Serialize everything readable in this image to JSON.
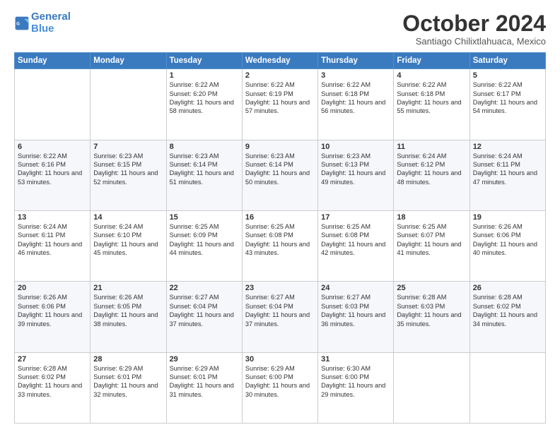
{
  "logo": {
    "line1": "General",
    "line2": "Blue"
  },
  "header": {
    "month_year": "October 2024",
    "location": "Santiago Chilixtlahuaca, Mexico"
  },
  "days_of_week": [
    "Sunday",
    "Monday",
    "Tuesday",
    "Wednesday",
    "Thursday",
    "Friday",
    "Saturday"
  ],
  "weeks": [
    [
      {
        "day": "",
        "empty": true
      },
      {
        "day": "",
        "empty": true
      },
      {
        "day": "1",
        "sunrise": "6:22 AM",
        "sunset": "6:20 PM",
        "daylight": "11 hours and 58 minutes."
      },
      {
        "day": "2",
        "sunrise": "6:22 AM",
        "sunset": "6:19 PM",
        "daylight": "11 hours and 57 minutes."
      },
      {
        "day": "3",
        "sunrise": "6:22 AM",
        "sunset": "6:18 PM",
        "daylight": "11 hours and 56 minutes."
      },
      {
        "day": "4",
        "sunrise": "6:22 AM",
        "sunset": "6:18 PM",
        "daylight": "11 hours and 55 minutes."
      },
      {
        "day": "5",
        "sunrise": "6:22 AM",
        "sunset": "6:17 PM",
        "daylight": "11 hours and 54 minutes."
      }
    ],
    [
      {
        "day": "6",
        "sunrise": "6:22 AM",
        "sunset": "6:16 PM",
        "daylight": "11 hours and 53 minutes."
      },
      {
        "day": "7",
        "sunrise": "6:23 AM",
        "sunset": "6:15 PM",
        "daylight": "11 hours and 52 minutes."
      },
      {
        "day": "8",
        "sunrise": "6:23 AM",
        "sunset": "6:14 PM",
        "daylight": "11 hours and 51 minutes."
      },
      {
        "day": "9",
        "sunrise": "6:23 AM",
        "sunset": "6:14 PM",
        "daylight": "11 hours and 50 minutes."
      },
      {
        "day": "10",
        "sunrise": "6:23 AM",
        "sunset": "6:13 PM",
        "daylight": "11 hours and 49 minutes."
      },
      {
        "day": "11",
        "sunrise": "6:24 AM",
        "sunset": "6:12 PM",
        "daylight": "11 hours and 48 minutes."
      },
      {
        "day": "12",
        "sunrise": "6:24 AM",
        "sunset": "6:11 PM",
        "daylight": "11 hours and 47 minutes."
      }
    ],
    [
      {
        "day": "13",
        "sunrise": "6:24 AM",
        "sunset": "6:11 PM",
        "daylight": "11 hours and 46 minutes."
      },
      {
        "day": "14",
        "sunrise": "6:24 AM",
        "sunset": "6:10 PM",
        "daylight": "11 hours and 45 minutes."
      },
      {
        "day": "15",
        "sunrise": "6:25 AM",
        "sunset": "6:09 PM",
        "daylight": "11 hours and 44 minutes."
      },
      {
        "day": "16",
        "sunrise": "6:25 AM",
        "sunset": "6:08 PM",
        "daylight": "11 hours and 43 minutes."
      },
      {
        "day": "17",
        "sunrise": "6:25 AM",
        "sunset": "6:08 PM",
        "daylight": "11 hours and 42 minutes."
      },
      {
        "day": "18",
        "sunrise": "6:25 AM",
        "sunset": "6:07 PM",
        "daylight": "11 hours and 41 minutes."
      },
      {
        "day": "19",
        "sunrise": "6:26 AM",
        "sunset": "6:06 PM",
        "daylight": "11 hours and 40 minutes."
      }
    ],
    [
      {
        "day": "20",
        "sunrise": "6:26 AM",
        "sunset": "6:06 PM",
        "daylight": "11 hours and 39 minutes."
      },
      {
        "day": "21",
        "sunrise": "6:26 AM",
        "sunset": "6:05 PM",
        "daylight": "11 hours and 38 minutes."
      },
      {
        "day": "22",
        "sunrise": "6:27 AM",
        "sunset": "6:04 PM",
        "daylight": "11 hours and 37 minutes."
      },
      {
        "day": "23",
        "sunrise": "6:27 AM",
        "sunset": "6:04 PM",
        "daylight": "11 hours and 37 minutes."
      },
      {
        "day": "24",
        "sunrise": "6:27 AM",
        "sunset": "6:03 PM",
        "daylight": "11 hours and 36 minutes."
      },
      {
        "day": "25",
        "sunrise": "6:28 AM",
        "sunset": "6:03 PM",
        "daylight": "11 hours and 35 minutes."
      },
      {
        "day": "26",
        "sunrise": "6:28 AM",
        "sunset": "6:02 PM",
        "daylight": "11 hours and 34 minutes."
      }
    ],
    [
      {
        "day": "27",
        "sunrise": "6:28 AM",
        "sunset": "6:02 PM",
        "daylight": "11 hours and 33 minutes."
      },
      {
        "day": "28",
        "sunrise": "6:29 AM",
        "sunset": "6:01 PM",
        "daylight": "11 hours and 32 minutes."
      },
      {
        "day": "29",
        "sunrise": "6:29 AM",
        "sunset": "6:01 PM",
        "daylight": "11 hours and 31 minutes."
      },
      {
        "day": "30",
        "sunrise": "6:29 AM",
        "sunset": "6:00 PM",
        "daylight": "11 hours and 30 minutes."
      },
      {
        "day": "31",
        "sunrise": "6:30 AM",
        "sunset": "6:00 PM",
        "daylight": "11 hours and 29 minutes."
      },
      {
        "day": "",
        "empty": true
      },
      {
        "day": "",
        "empty": true
      }
    ]
  ]
}
